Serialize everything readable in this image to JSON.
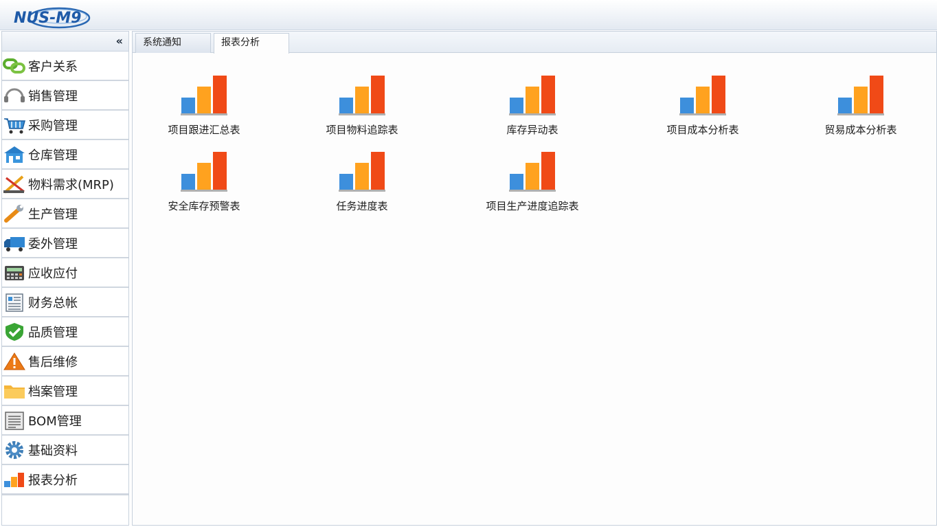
{
  "app": {
    "logo_text": "NUS-M9"
  },
  "colors": {
    "bar_blue": "#3d8fdc",
    "bar_light_orange": "#ffa21f",
    "bar_dark_orange": "#f04a17",
    "accent": "#2a68b3"
  },
  "sidebar": {
    "collapse_glyph": "«",
    "items": [
      {
        "label": "客户关系",
        "icon": "chain-link-icon"
      },
      {
        "label": "销售管理",
        "icon": "headset-icon"
      },
      {
        "label": "采购管理",
        "icon": "shopping-cart-icon"
      },
      {
        "label": "仓库管理",
        "icon": "warehouse-icon"
      },
      {
        "label": "物料需求(MRP)",
        "icon": "drafting-tools-icon"
      },
      {
        "label": "生产管理",
        "icon": "wrench-icon"
      },
      {
        "label": "委外管理",
        "icon": "truck-icon"
      },
      {
        "label": "应收应付",
        "icon": "calculator-icon"
      },
      {
        "label": "财务总帐",
        "icon": "ledger-icon"
      },
      {
        "label": "品质管理",
        "icon": "check-shield-icon"
      },
      {
        "label": "售后维修",
        "icon": "warning-icon"
      },
      {
        "label": "档案管理",
        "icon": "folder-icon"
      },
      {
        "label": "BOM管理",
        "icon": "document-icon"
      },
      {
        "label": "基础资料",
        "icon": "gear-icon"
      },
      {
        "label": "报表分析",
        "icon": "bar-chart-icon"
      }
    ]
  },
  "tabs": [
    {
      "label": "系统通知",
      "active": false
    },
    {
      "label": "报表分析",
      "active": true
    }
  ],
  "reports": [
    {
      "label": "项目跟进汇总表"
    },
    {
      "label": "项目物料追踪表"
    },
    {
      "label": "库存异动表"
    },
    {
      "label": "项目成本分析表"
    },
    {
      "label": "贸易成本分析表"
    },
    {
      "label": "安全库存预警表"
    },
    {
      "label": "任务进度表"
    },
    {
      "label": "项目生产进度追踪表"
    }
  ]
}
